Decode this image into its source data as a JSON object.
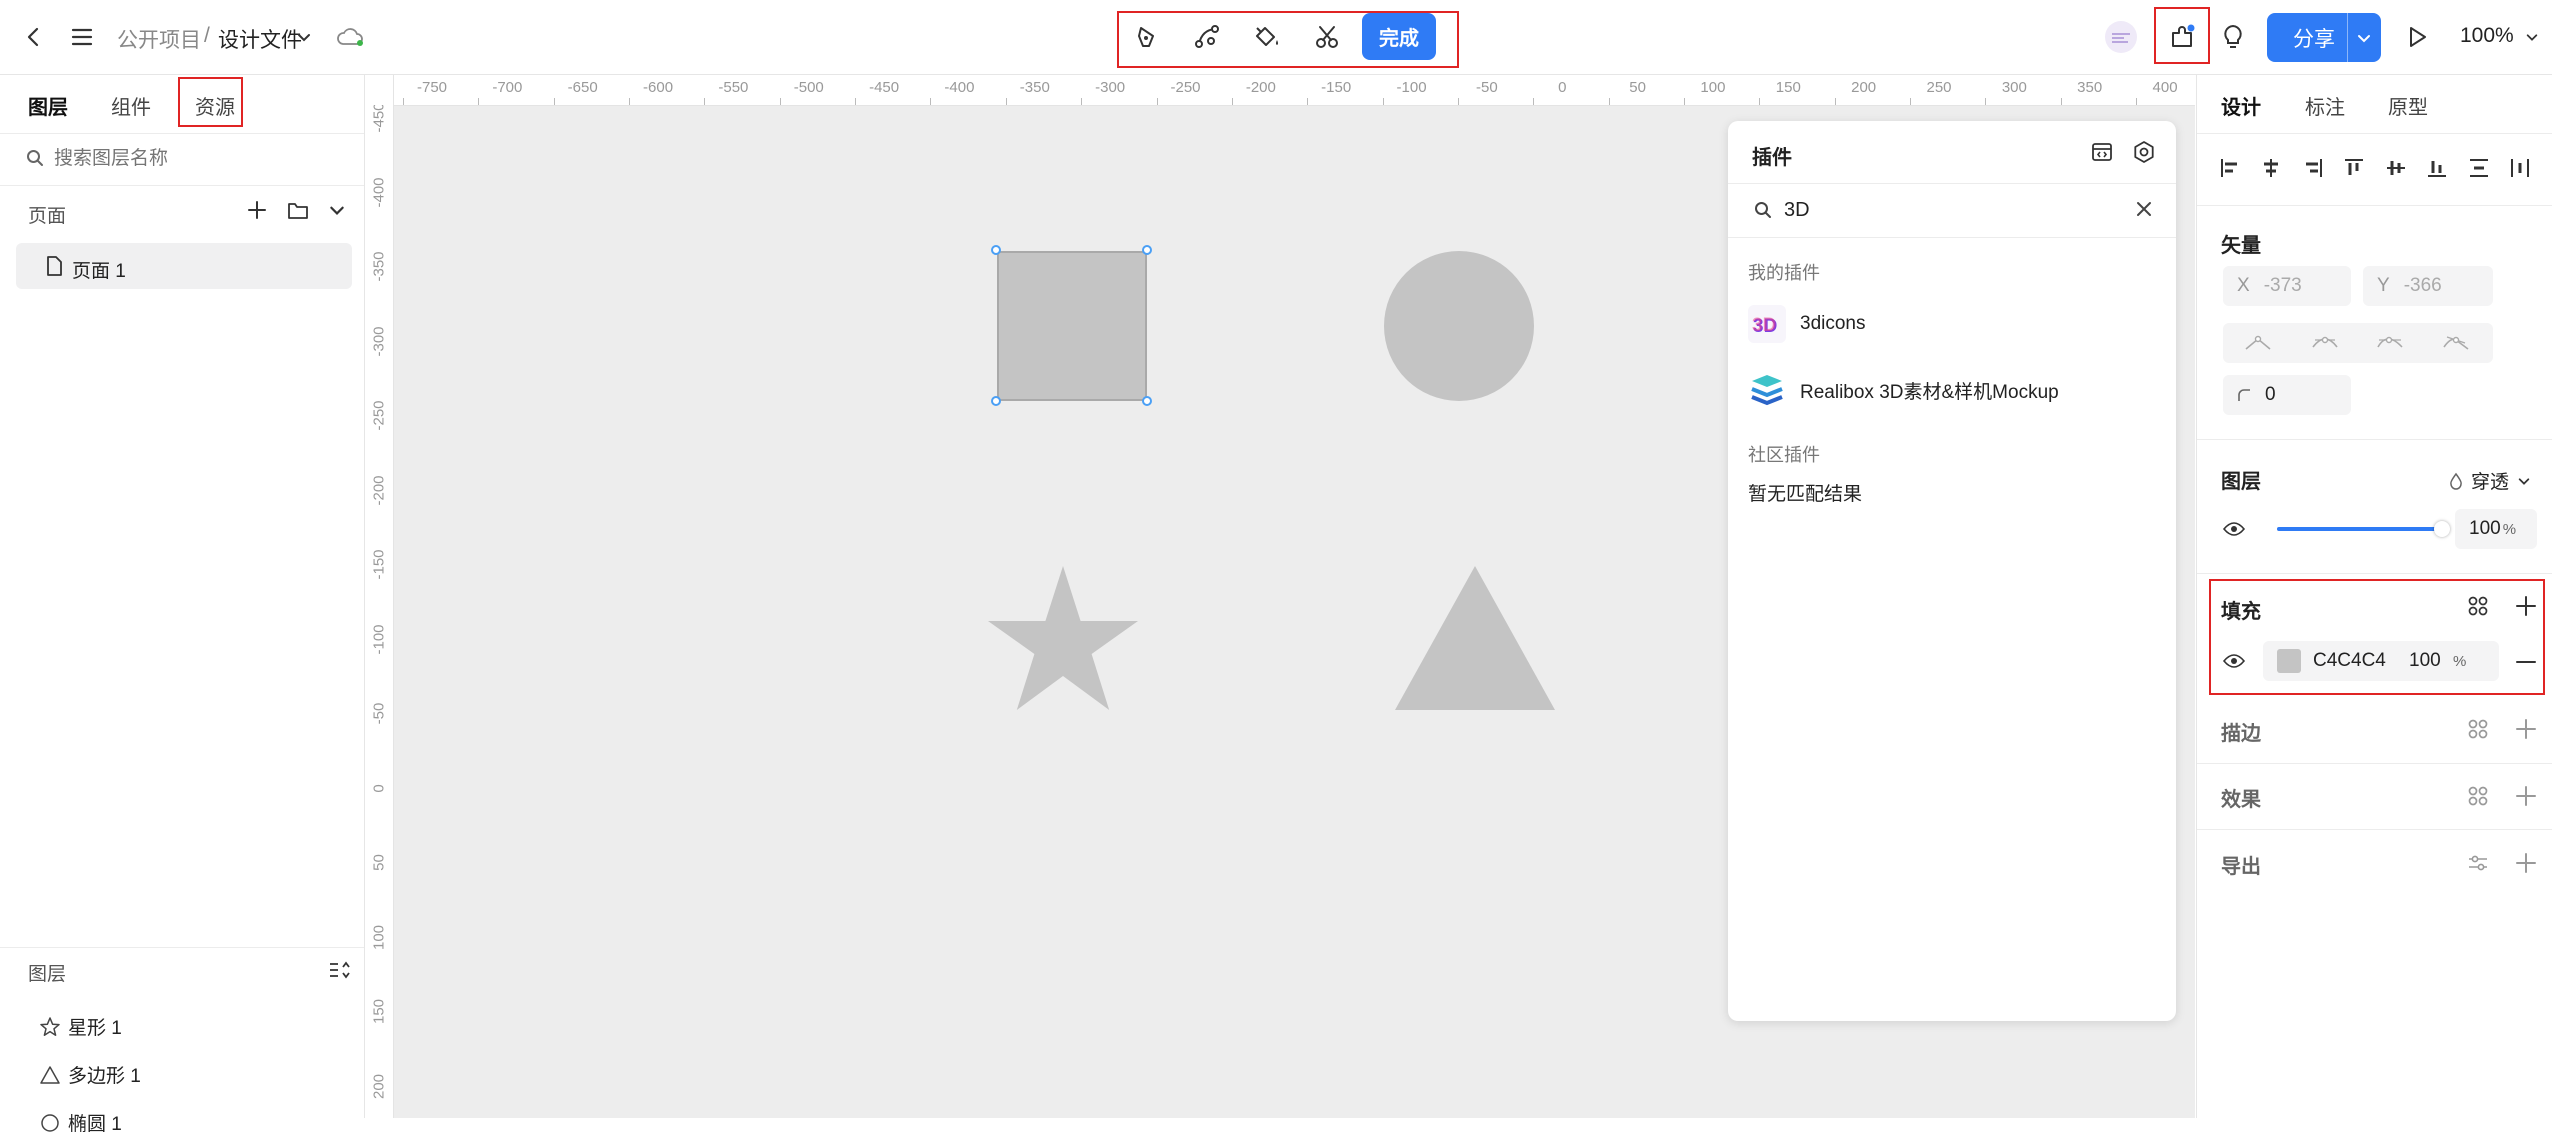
{
  "topbar": {
    "breadcrumb_project": "公开项目",
    "breadcrumb_sep": "/",
    "file_name": "设计文件",
    "done_label": "完成",
    "share_label": "分享",
    "zoom": "100%"
  },
  "left_panel": {
    "tabs": [
      {
        "label": "图层",
        "active": true
      },
      {
        "label": "组件",
        "active": false
      },
      {
        "label": "资源",
        "active": false
      }
    ],
    "search_placeholder": "搜索图层名称",
    "pages_title": "页面",
    "pages": [
      {
        "label": "页面 1",
        "selected": true
      }
    ],
    "layers_title": "图层",
    "layers": [
      {
        "label": "星形 1",
        "icon": "star-icon"
      },
      {
        "label": "多边形 1",
        "icon": "triangle-icon"
      },
      {
        "label": "椭圆 1",
        "icon": "circle-icon"
      }
    ]
  },
  "ruler": {
    "h_ticks": [
      "-750",
      "-700",
      "-650",
      "-600",
      "-550",
      "-500",
      "-450",
      "-400",
      "-350",
      "-300",
      "-250",
      "-200",
      "-150",
      "-100",
      "-50",
      "0",
      "50",
      "100",
      "150",
      "200",
      "250",
      "300",
      "350",
      "400"
    ],
    "v_ticks": [
      "-450",
      "-400",
      "-350",
      "-300",
      "-250",
      "-200",
      "-150",
      "-100",
      "-50",
      "0",
      "50",
      "100",
      "150",
      "200"
    ]
  },
  "plugin_panel": {
    "title": "插件",
    "search_value": "3D",
    "my_plugins_title": "我的插件",
    "my_plugins": [
      {
        "name": "3dicons"
      },
      {
        "name": "Realibox 3D素材&样机Mockup"
      }
    ],
    "community_title": "社区插件",
    "no_result": "暂无匹配结果"
  },
  "right_panel": {
    "tabs": [
      {
        "label": "设计",
        "active": true
      },
      {
        "label": "标注",
        "active": false
      },
      {
        "label": "原型",
        "active": false
      }
    ],
    "vector_title": "矢量",
    "x_label": "X",
    "x_value": "-373",
    "y_label": "Y",
    "y_value": "-366",
    "corner_value": "0",
    "layer_title": "图层",
    "blend_mode": "穿透",
    "opacity_value": "100",
    "opacity_unit": "%",
    "opacity_fraction": 1.0,
    "fill_title": "填充",
    "fill_color_hex": "C4C4C4",
    "fill_opacity": "100",
    "fill_opacity_unit": "%",
    "stroke_title": "描边",
    "effect_title": "效果",
    "export_title": "导出"
  },
  "colors": {
    "accent": "#2f7bf5",
    "shape_fill": "#c4c4c4",
    "highlight": "#e02424",
    "selection": "#4a9ff5"
  }
}
